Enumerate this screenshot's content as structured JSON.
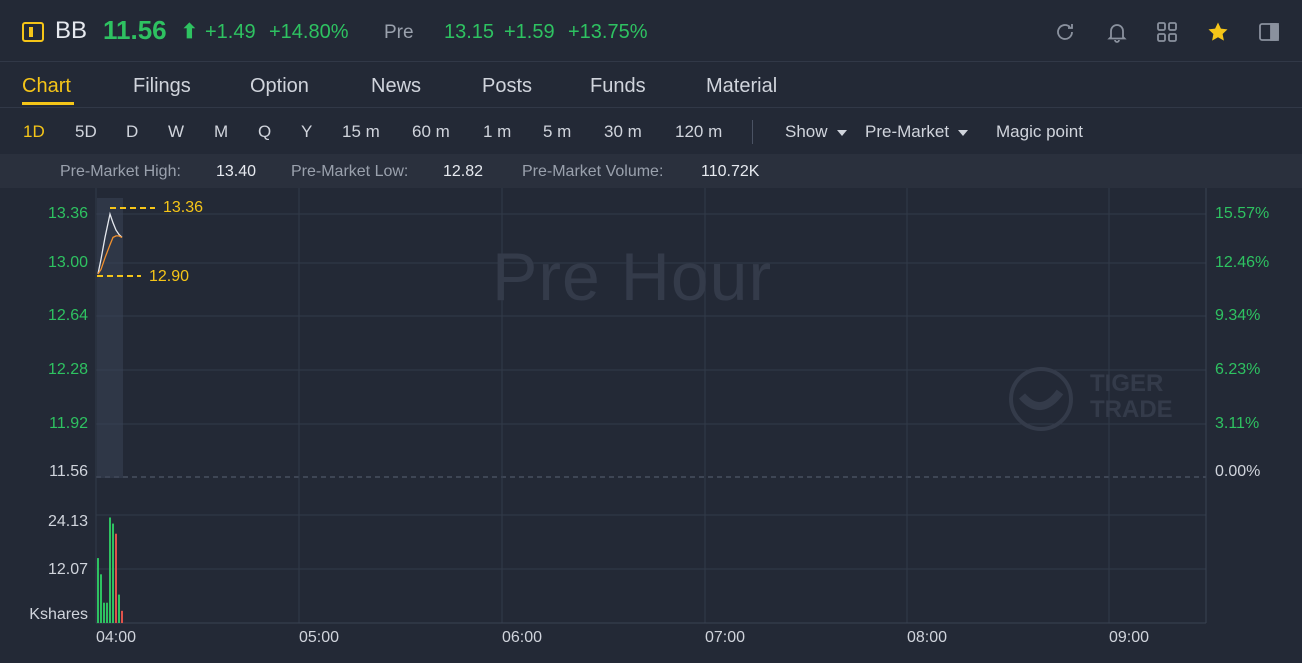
{
  "header": {
    "symbol": "BB",
    "price": "11.56",
    "arrow": "⬆",
    "change": "+1.49",
    "change_pct": "+14.80%",
    "pre_label": "Pre",
    "pre_price": "13.15",
    "pre_change": "+1.59",
    "pre_change_pct": "+13.75%",
    "up_color": "#2ec261",
    "accent": "#f5c518"
  },
  "tabs": [
    {
      "label": "Chart",
      "active": true
    },
    {
      "label": "Filings"
    },
    {
      "label": "Option"
    },
    {
      "label": "News"
    },
    {
      "label": "Posts"
    },
    {
      "label": "Funds"
    },
    {
      "label": "Material"
    }
  ],
  "toolbar": {
    "periods": [
      "1D",
      "5D",
      "D",
      "W",
      "M",
      "Q",
      "Y",
      "15 m",
      "60 m",
      "1 m",
      "5 m",
      "30 m",
      "120 m"
    ],
    "active_period": "1D",
    "show_label": "Show",
    "session_label": "Pre-Market",
    "magic_label": "Magic point"
  },
  "stats": {
    "high_label": "Pre-Market High:",
    "high_value": "13.40",
    "low_label": "Pre-Market Low:",
    "low_value": "12.82",
    "volume_label": "Pre-Market Volume:",
    "volume_value": "110.72K"
  },
  "chart": {
    "watermark": "Pre Hour",
    "logo_line1": "TIGER",
    "logo_line2": "TRADE",
    "high_marker": "13.36",
    "low_marker": "12.90",
    "volume_unit": "Kshares"
  },
  "chart_data": {
    "type": "line",
    "price_axis": [
      "13.36",
      "13.00",
      "12.64",
      "12.28",
      "11.92",
      "11.56"
    ],
    "pct_axis": [
      "15.57%",
      "12.46%",
      "9.34%",
      "6.23%",
      "3.11%",
      "0.00%"
    ],
    "volume_axis": [
      "24.13",
      "12.07"
    ],
    "x_ticks": [
      "04:00",
      "05:00",
      "06:00",
      "07:00",
      "08:00",
      "09:00"
    ],
    "price_series": [
      12.95,
      13.05,
      13.2,
      13.36,
      13.3,
      13.25,
      13.22,
      13.2
    ],
    "avg_series": [
      12.95,
      12.98,
      13.06,
      13.15,
      13.2,
      13.21,
      13.21,
      13.2
    ],
    "volume_bars": [
      {
        "v": 16,
        "color": "#2ec261"
      },
      {
        "v": 12,
        "color": "#2ec261"
      },
      {
        "v": 5,
        "color": "#2ec261"
      },
      {
        "v": 5,
        "color": "#2ec261"
      },
      {
        "v": 26,
        "color": "#2ec261"
      },
      {
        "v": 24.5,
        "color": "#2ec261"
      },
      {
        "v": 22,
        "color": "#e0524b"
      },
      {
        "v": 7,
        "color": "#2ec261"
      },
      {
        "v": 3,
        "color": "#e0524b"
      }
    ],
    "baseline": 11.56
  }
}
